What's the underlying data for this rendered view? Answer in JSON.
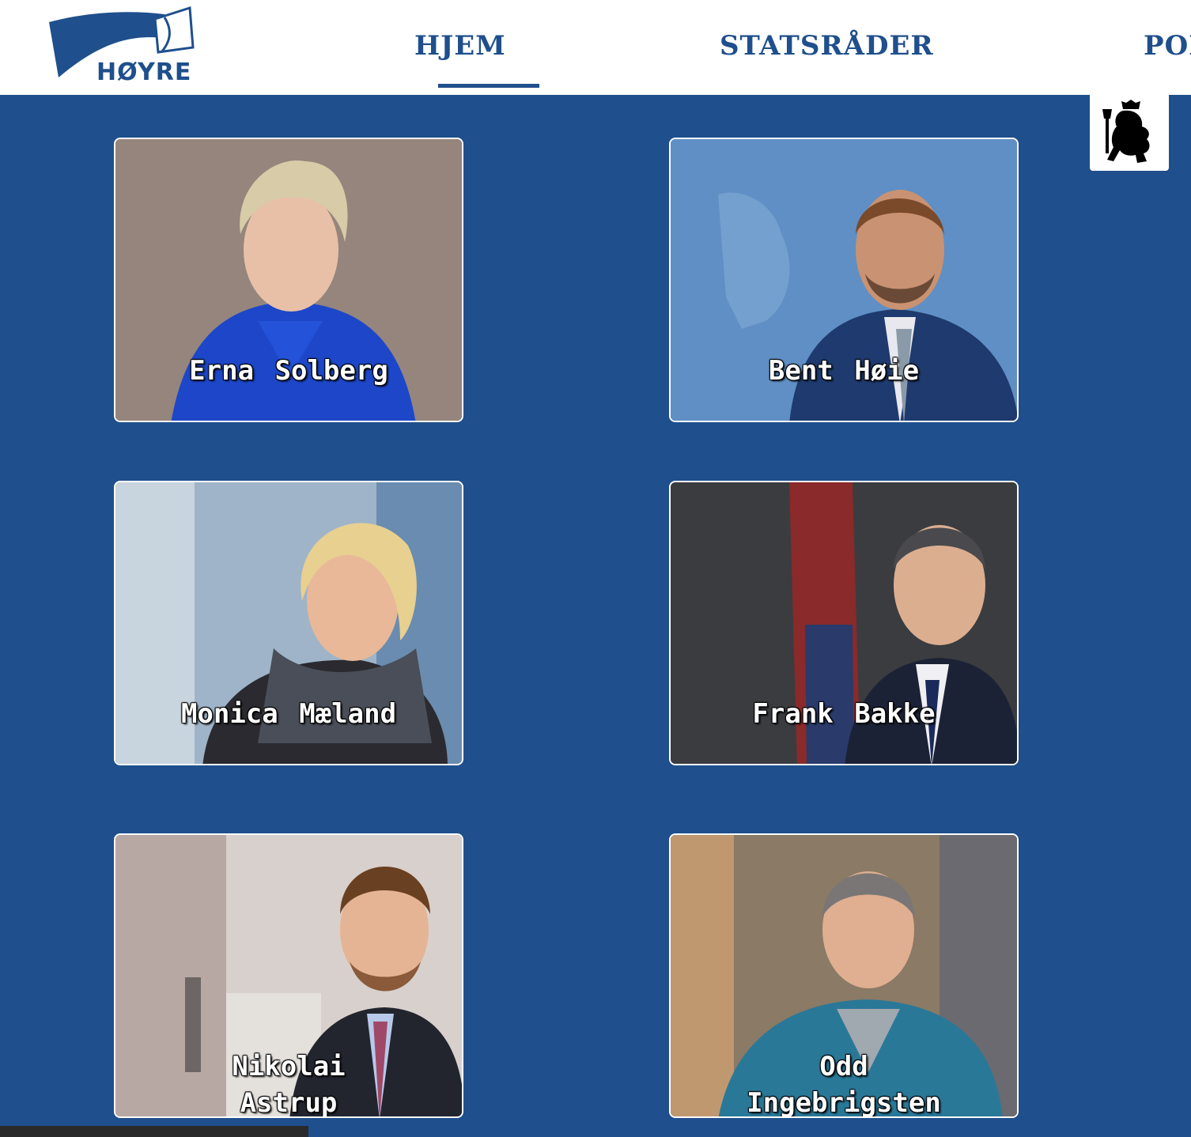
{
  "header": {
    "logo_text": "HØYRE",
    "nav": {
      "home": "HJEM",
      "statsrader": "STATSRÅDER",
      "politikk": "POI"
    }
  },
  "cards": [
    {
      "name": "Erna Solberg",
      "line1": "Erna Solberg",
      "line2": ""
    },
    {
      "name": "Bent Høie",
      "line1": "Bent Høie",
      "line2": ""
    },
    {
      "name": "Monica Mæland",
      "line1": "Monica Mæland",
      "line2": ""
    },
    {
      "name": "Frank Bakke",
      "line1": "Frank Bakke",
      "line2": ""
    },
    {
      "name": "Nikolai Astrup",
      "line1": "Nikolai",
      "line2": "Astrup"
    },
    {
      "name": "Odd Ingebrigsten",
      "line1": "Odd",
      "line2": "Ingebrigsten"
    }
  ],
  "colors": {
    "brand_blue": "#1f4f8c",
    "header_bg": "#ffffff"
  }
}
